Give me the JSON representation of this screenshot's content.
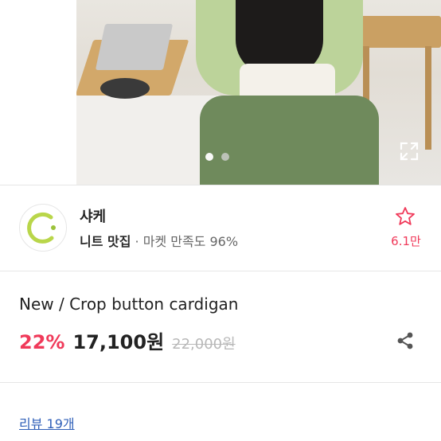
{
  "hero": {
    "image_alt": "Green knit crop cardigan product photo",
    "carousel_total": 2,
    "carousel_active": 1,
    "expand_icon": "expand-icon"
  },
  "shop": {
    "name": "샤케",
    "tag_prefix": "니트 맛집",
    "separator": " · ",
    "satisfaction": "마켓 만족도 96%",
    "likes": "6.1만",
    "favorite_icon": "star-outline-icon",
    "accent": "#f03a5a"
  },
  "product": {
    "title": "New / Crop button cardigan",
    "discount": "22%",
    "price": "17,100원",
    "original_price": "22,000원",
    "share_icon": "share-icon"
  },
  "reviews": {
    "label": "리뷰 19개"
  }
}
